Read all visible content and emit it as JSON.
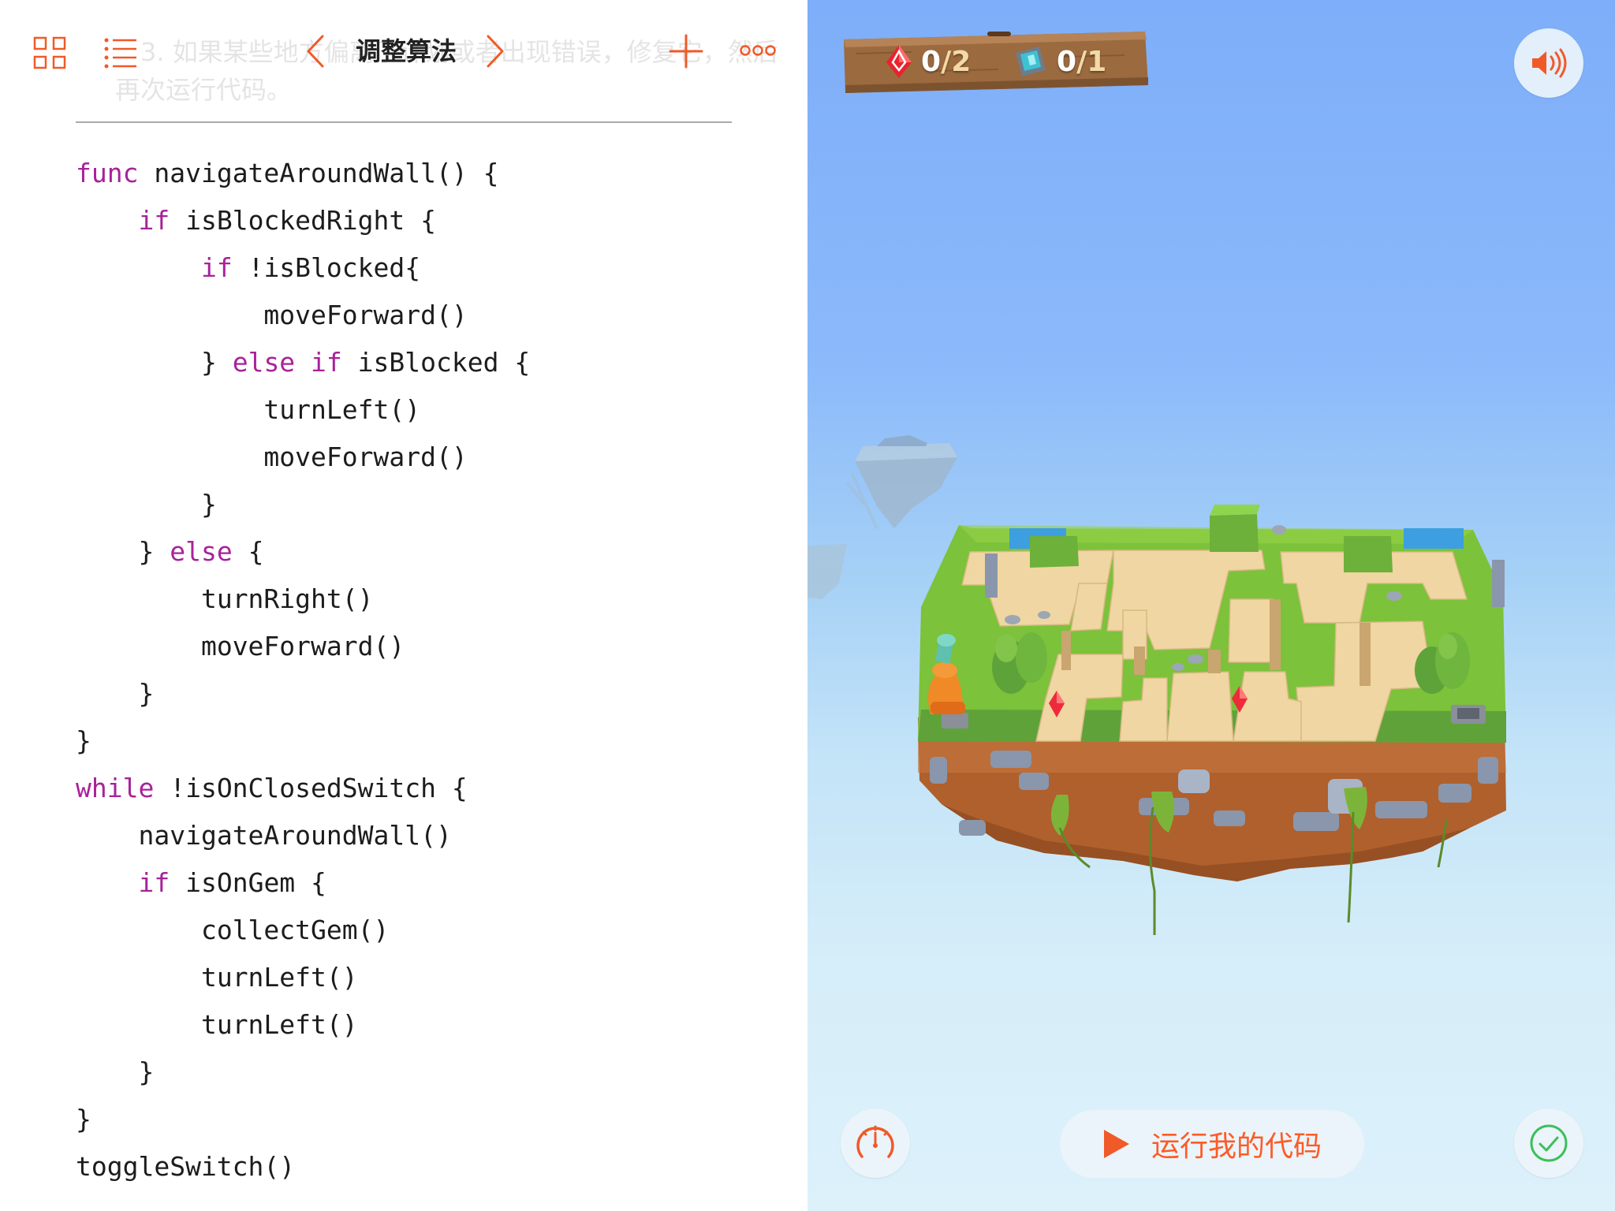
{
  "toolbar": {
    "title": "调整算法",
    "icons": [
      "grid-icon",
      "list-icon",
      "chevron-left-icon",
      "chevron-right-icon",
      "plus-icon",
      "more-icon"
    ],
    "accent": "#f05a28"
  },
  "instructions_ghost": {
    "line1": "3. 如果某些地方偏离了计划或者出现错误，修复它，然后",
    "line2": "再次运行代码。"
  },
  "code": {
    "keyword_color": "#a8229a",
    "lines": [
      {
        "kw": "func",
        "text": " navigateAroundWall() {"
      },
      {
        "indent": "    ",
        "kw": "if",
        "text": " isBlockedRight {"
      },
      {
        "indent": "        ",
        "kw": "if",
        "text": " !isBlocked{"
      },
      {
        "indent": "            ",
        "text": "moveForward()"
      },
      {
        "indent": "        ",
        "pre": "} ",
        "kw": "else if",
        "text": " isBlocked {"
      },
      {
        "indent": "            ",
        "text": "turnLeft()"
      },
      {
        "indent": "            ",
        "text": "moveForward()"
      },
      {
        "indent": "        ",
        "text": "}"
      },
      {
        "indent": "    ",
        "pre": "} ",
        "kw": "else",
        "text": " {"
      },
      {
        "indent": "        ",
        "text": "turnRight()"
      },
      {
        "indent": "        ",
        "text": "moveForward()"
      },
      {
        "indent": "    ",
        "text": "}"
      },
      {
        "text": "}"
      },
      {
        "kw": "while",
        "text": " !isOnClosedSwitch {"
      },
      {
        "indent": "    ",
        "text": "navigateAroundWall()"
      },
      {
        "indent": "    ",
        "kw": "if",
        "text": " isOnGem {"
      },
      {
        "indent": "        ",
        "text": "collectGem()"
      },
      {
        "indent": "        ",
        "text": "turnLeft()"
      },
      {
        "indent": "        ",
        "text": "turnLeft()"
      },
      {
        "indent": "    ",
        "text": "}"
      },
      {
        "text": "}"
      },
      {
        "text": "toggleSwitch()"
      }
    ]
  },
  "game": {
    "gems": {
      "collected": "0",
      "total": "2",
      "icon": "gem-icon"
    },
    "switches": {
      "toggled": "0",
      "total": "1",
      "icon": "switch-icon"
    },
    "sound_icon": "speaker-icon",
    "speed_icon": "speedometer-icon",
    "check_icon": "checkmark-icon",
    "run_label": "运行我的代码",
    "run_icon": "play-icon",
    "colors": {
      "grass": "#7cc23a",
      "sand": "#f0d6a2",
      "dirt": "#b4612e",
      "water": "#3d9ee0",
      "gem": "#ee2b3a"
    }
  }
}
